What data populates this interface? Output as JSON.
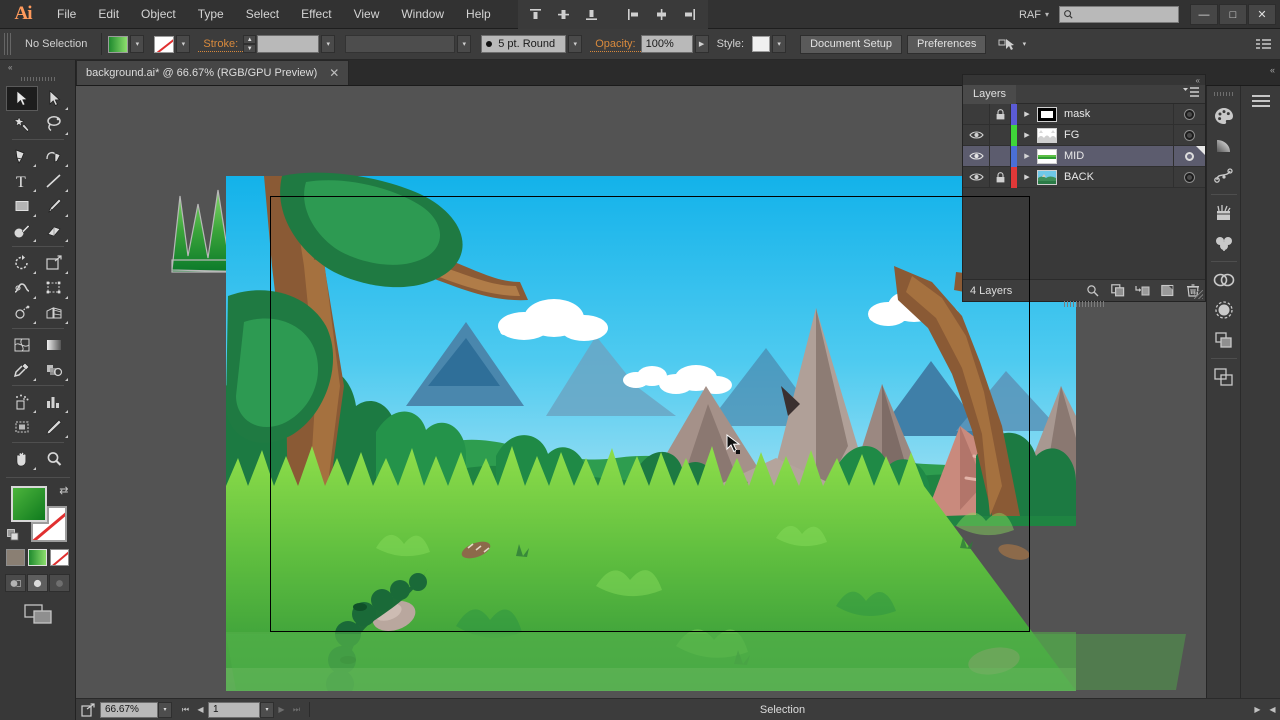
{
  "app": {
    "name": "Ai",
    "title": "Adobe Illustrator"
  },
  "menubar": {
    "items": [
      "File",
      "Edit",
      "Object",
      "Type",
      "Select",
      "Effect",
      "View",
      "Window",
      "Help"
    ],
    "workspace": "RAF",
    "workspace_caret": "▾",
    "search_placeholder": "",
    "align_icons": [
      "align-top-icon",
      "align-vertical-center-icon",
      "align-bottom-icon",
      "align-left-icon",
      "align-horizontal-center-icon",
      "align-right-icon"
    ],
    "window_controls": {
      "minimize": "—",
      "maximize": "□",
      "close": "✕"
    }
  },
  "controlbar": {
    "selection_status": "No Selection",
    "fill_label": "fill-swatch",
    "stroke_swatch_label": "stroke-none-swatch",
    "stroke_label": "Stroke:",
    "stroke_weight": "",
    "stroke_profile": "",
    "brush": "5 pt. Round",
    "opacity_label": "Opacity:",
    "opacity_value": "100%",
    "style_label": "Style:",
    "document_setup": "Document Setup",
    "preferences": "Preferences",
    "caret": "▾"
  },
  "tabbar": {
    "document_title": "background.ai* @ 66.67% (RGB/GPU Preview)",
    "close_glyph": "✕",
    "collapse_glyph": "«"
  },
  "toolbar": {
    "collapse_glyph": "«",
    "tools": [
      {
        "name": "selection-tool",
        "active": true
      },
      {
        "name": "direct-selection-tool",
        "active": false
      },
      {
        "name": "magic-wand-tool",
        "active": false
      },
      {
        "name": "lasso-tool",
        "active": false
      },
      {
        "name": "pen-tool",
        "active": false
      },
      {
        "name": "curvature-tool",
        "active": false
      },
      {
        "name": "type-tool",
        "active": false
      },
      {
        "name": "line-segment-tool",
        "active": false
      },
      {
        "name": "rectangle-tool",
        "active": false
      },
      {
        "name": "paintbrush-tool",
        "active": false
      },
      {
        "name": "blob-brush-tool",
        "active": false
      },
      {
        "name": "eraser-tool",
        "active": false
      },
      {
        "name": "rotate-tool",
        "active": false
      },
      {
        "name": "scale-tool",
        "active": false
      },
      {
        "name": "width-tool",
        "active": false
      },
      {
        "name": "free-transform-tool",
        "active": false
      },
      {
        "name": "shape-builder-tool",
        "active": false
      },
      {
        "name": "perspective-grid-tool",
        "active": false
      },
      {
        "name": "mesh-tool",
        "active": false
      },
      {
        "name": "gradient-tool",
        "active": false
      },
      {
        "name": "eyedropper-tool",
        "active": false
      },
      {
        "name": "blend-tool",
        "active": false
      },
      {
        "name": "symbol-sprayer-tool",
        "active": false
      },
      {
        "name": "column-graph-tool",
        "active": false
      },
      {
        "name": "artboard-tool",
        "active": false
      },
      {
        "name": "slice-tool",
        "active": false
      },
      {
        "name": "hand-tool",
        "active": false
      },
      {
        "name": "zoom-tool",
        "active": false
      }
    ],
    "fill_color": "#2f9c34",
    "stroke_color": "none",
    "swap_glyph": "⇄",
    "mode_swatches": [
      "color-swatch",
      "gradient-swatch",
      "none-swatch"
    ],
    "draw_modes": [
      "draw-normal",
      "draw-behind",
      "draw-inside"
    ],
    "screen_mode": "change-screen-mode"
  },
  "layers_panel": {
    "tab_label": "Layers",
    "menu_glyph": "≡",
    "collapse_glyph": "«",
    "columns": {
      "visibility": "eye-icon",
      "lock": "lock-icon",
      "expand": "▶"
    },
    "layers": [
      {
        "name": "mask",
        "visible": false,
        "locked": true,
        "color": "#5b5bd6",
        "selected": false,
        "thumb": "mask-thumb"
      },
      {
        "name": "FG",
        "visible": true,
        "locked": false,
        "color": "#3fd639",
        "selected": false,
        "thumb": "fg-thumb"
      },
      {
        "name": "MID",
        "visible": true,
        "locked": false,
        "color": "#4a6fd6",
        "selected": true,
        "thumb": "mid-thumb"
      },
      {
        "name": "BACK",
        "visible": true,
        "locked": true,
        "color": "#e03838",
        "selected": false,
        "thumb": "back-thumb"
      }
    ],
    "footer": {
      "count": "4 Layers",
      "icons": [
        "locate-object-icon",
        "make-clipping-mask-icon",
        "create-new-sublayer-icon",
        "create-new-layer-icon",
        "delete-selection-icon"
      ]
    }
  },
  "right_dock": {
    "icons": [
      "color-panel-icon",
      "gradient-panel-icon",
      "stroke-panel-icon",
      "brushes-panel-icon",
      "symbols-panel-icon",
      "cc-libraries-panel-icon",
      "appearance-panel-icon",
      "graphic-styles-panel-icon",
      "artboards-panel-icon"
    ],
    "menu_icon": "hamburger-menu-icon"
  },
  "statusbar": {
    "export_icon": "export-selection-icon",
    "zoom_level": "66.67%",
    "artboard_number": "1",
    "status_text": "Selection",
    "caret": "▾",
    "nav_first": "⏮",
    "nav_prev": "◀",
    "nav_next": "▶",
    "nav_last": "⏭"
  },
  "canvas": {
    "artwork_title": "cartoon-jungle-background",
    "artboard_label": "artboard-1",
    "cursor": "selection-arrow-cursor",
    "loose_shape": "grass-tuft-shape",
    "colors": {
      "sky_top": "#18b4e9",
      "sky_bottom": "#8fd8f2",
      "grass_light": "#8ede4a",
      "grass_mid": "#4bb03a",
      "grass_dark": "#2b8c34",
      "rock_grey": "#9b8b80",
      "rock_pink": "#c98a7d",
      "trunk_brown": "#8a5a35",
      "foliage_dark": "#1f7a42",
      "mountain_blue": "#3f7fa8",
      "canvas_bg": "#535353"
    }
  }
}
